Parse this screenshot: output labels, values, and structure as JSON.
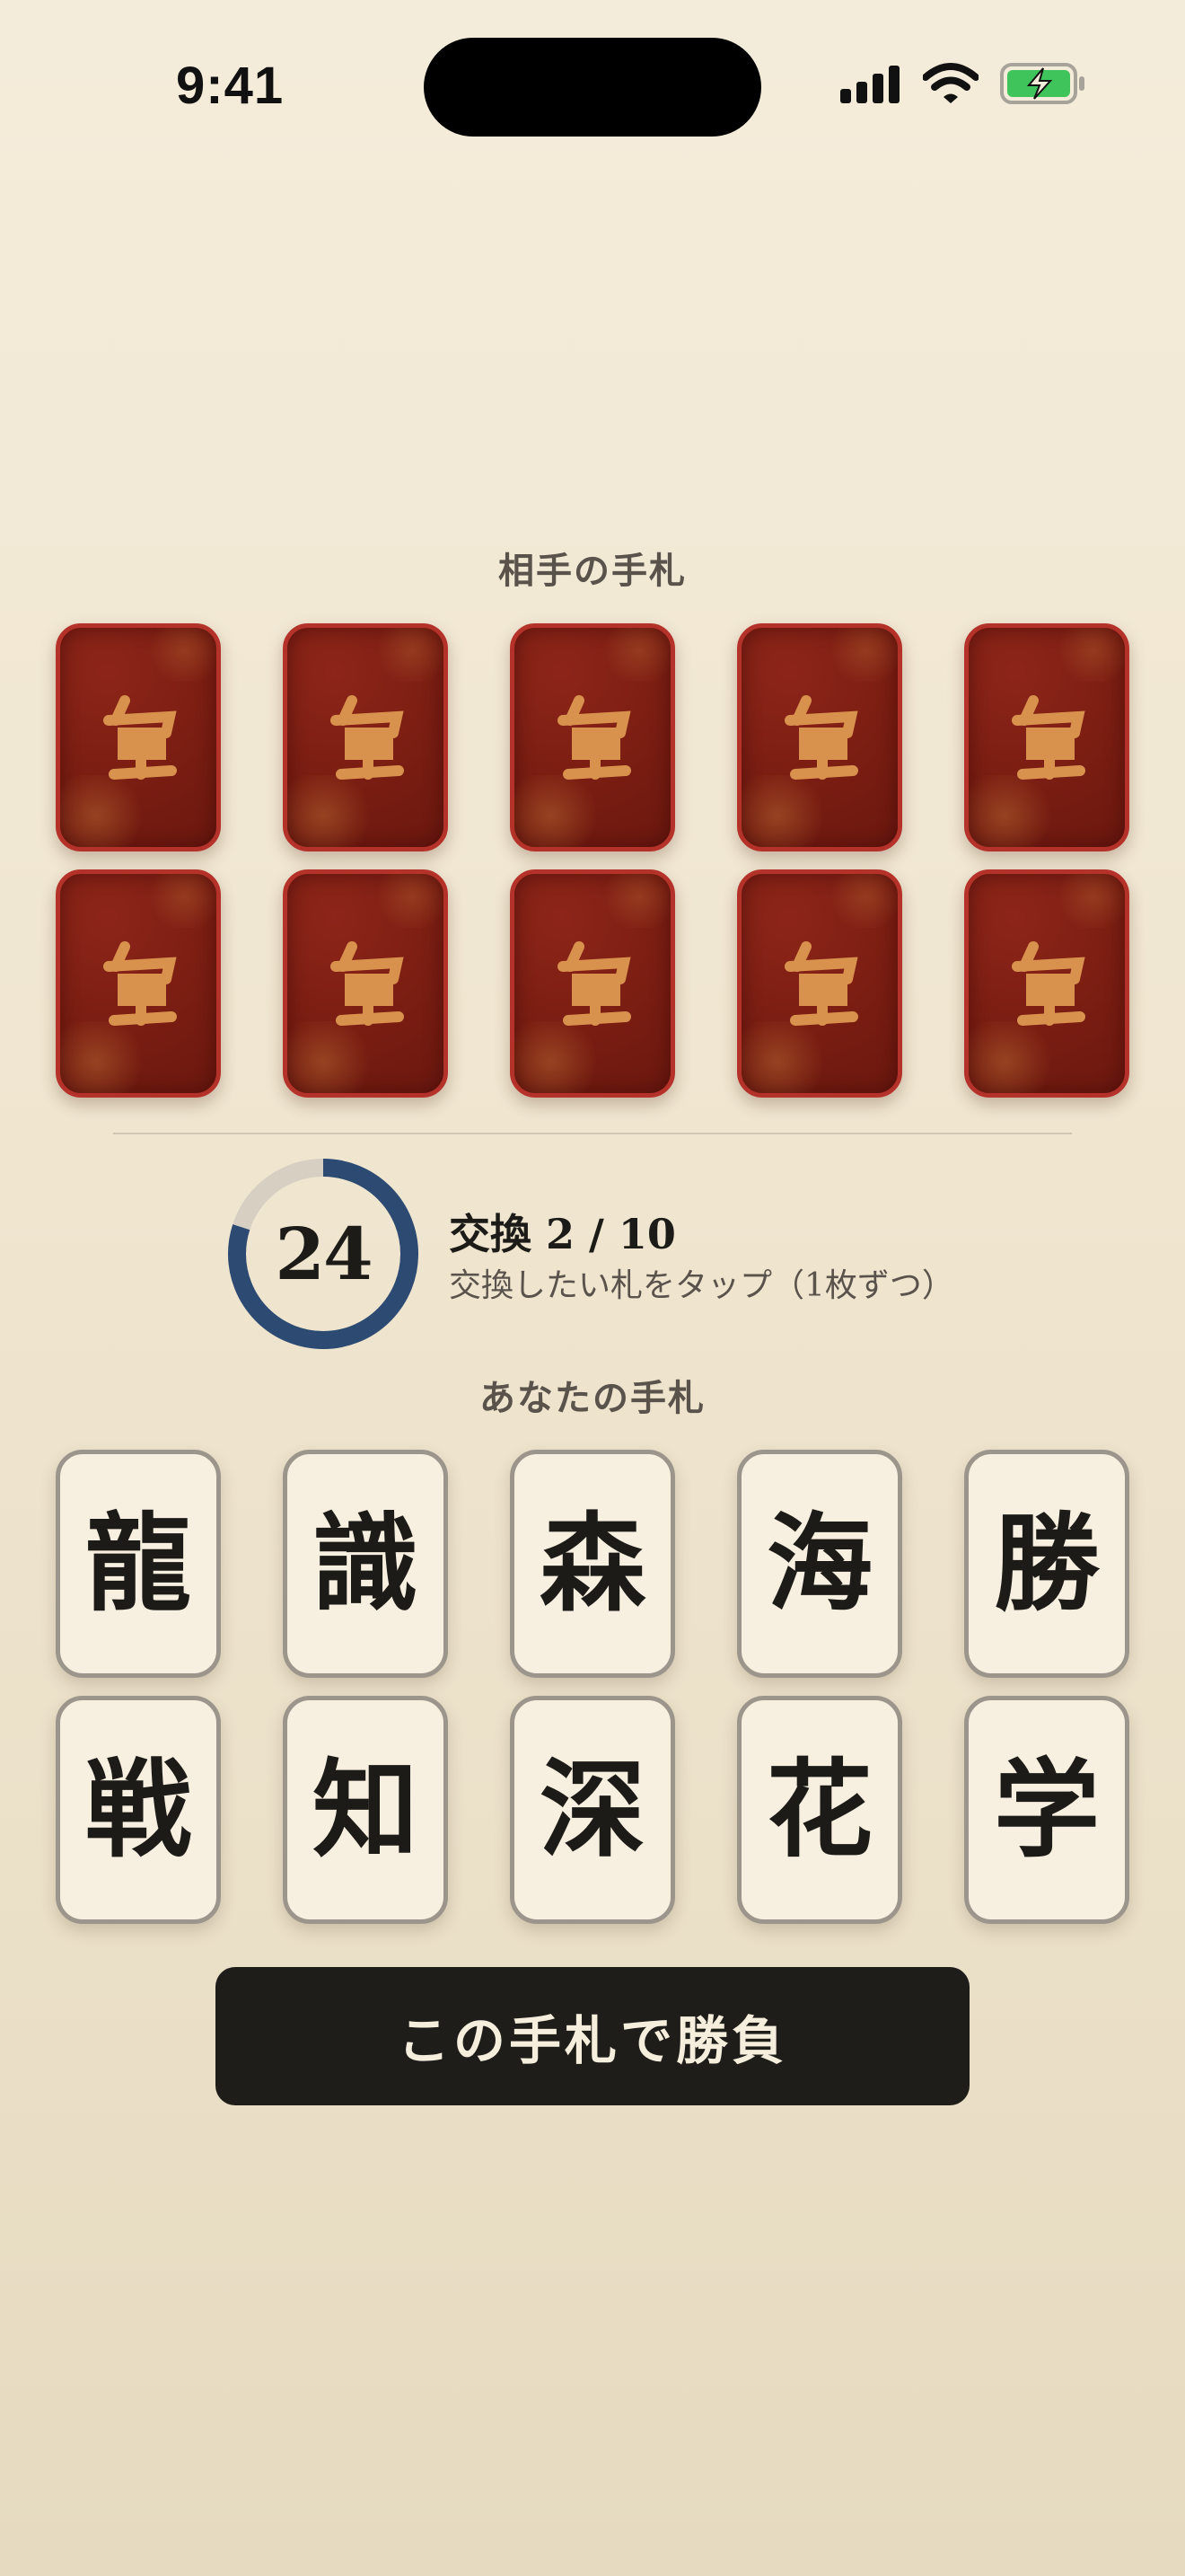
{
  "status_bar": {
    "time": "9:41"
  },
  "opponent": {
    "title": "相手の手札",
    "back_glyph": "㐃",
    "card_count": 10
  },
  "timer": {
    "seconds": "24",
    "progress": 0.8,
    "ring_color": "#2c4a72",
    "track_color": "#d6cfc2"
  },
  "exchange": {
    "count_label": "交換 2 / 10",
    "hint": "交換したい札をタップ（1枚ずつ）"
  },
  "player": {
    "title": "あなたの手札",
    "cards": [
      "龍",
      "識",
      "森",
      "海",
      "勝",
      "戦",
      "知",
      "深",
      "花",
      "学"
    ]
  },
  "confirm_button": {
    "label": "この手札で勝負"
  },
  "colors": {
    "card_back": "#7a1d12",
    "card_back_border": "#b4322a",
    "glyph": "#d9924e",
    "button": "#1f1d1a"
  }
}
